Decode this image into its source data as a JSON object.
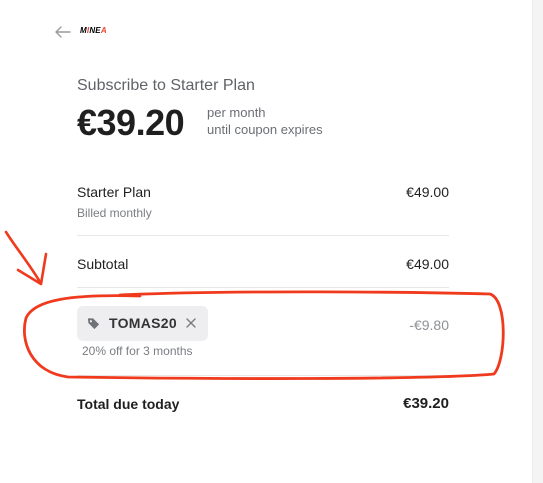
{
  "header": {
    "logo_text": "MINEA",
    "back_icon": "arrow-left-icon"
  },
  "summary": {
    "title": "Subscribe to Starter Plan",
    "price": "€39.20",
    "price_note_line1": "per month",
    "price_note_line2": "until coupon expires"
  },
  "line_items": {
    "plan_name": "Starter Plan",
    "plan_billing": "Billed monthly",
    "plan_amount": "€49.00",
    "subtotal_label": "Subtotal",
    "subtotal_amount": "€49.00"
  },
  "coupon": {
    "icon": "tag-icon",
    "code": "TOMAS20",
    "remove_icon": "close-icon",
    "description": "20% off for 3 months",
    "amount": "-€9.80"
  },
  "total": {
    "label": "Total due today",
    "amount": "€39.20"
  },
  "colors": {
    "annotation": "#f03a1e",
    "text_primary": "#1f1f1f",
    "text_muted": "#6b6f75",
    "pill_background": "#eeeef0"
  }
}
